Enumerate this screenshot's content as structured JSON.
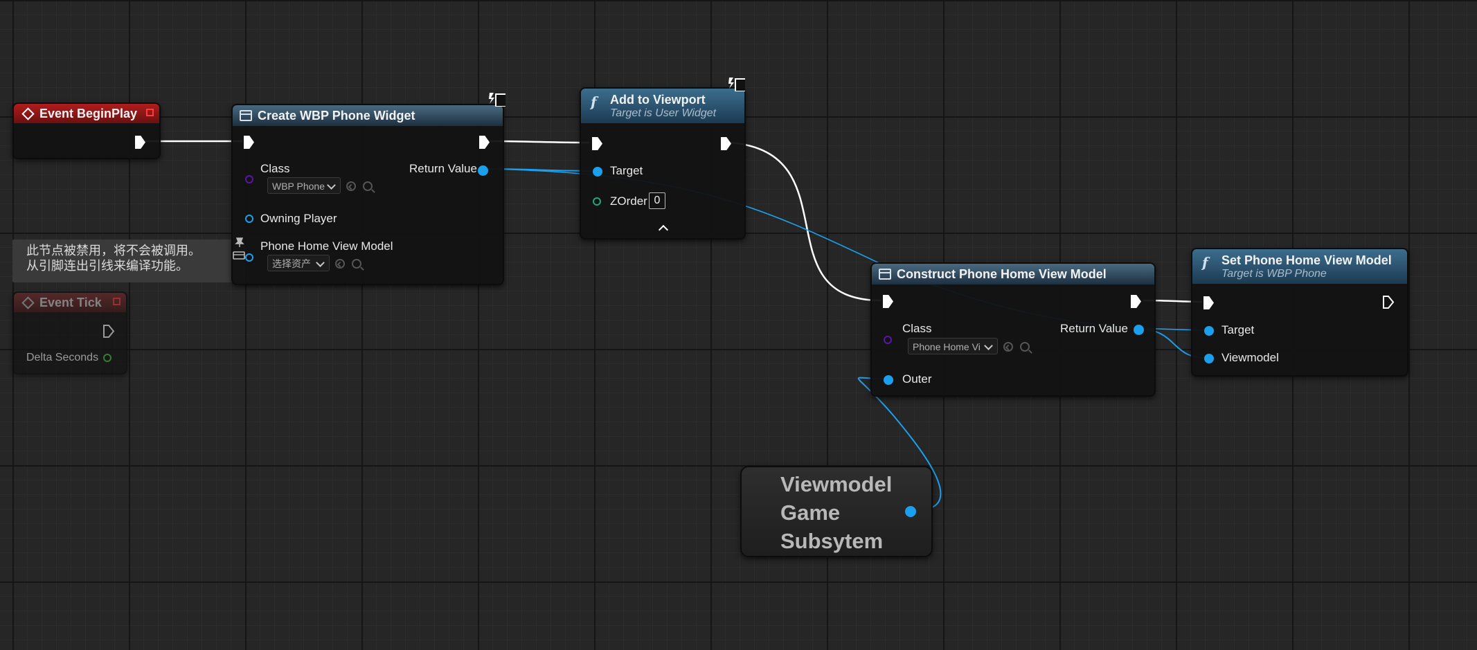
{
  "tooltip": {
    "line1": "此节点被禁用，将不会被调用。",
    "line2": "从引脚连出引线来编译功能。"
  },
  "event_beginplay": {
    "title": "Event BeginPlay"
  },
  "event_tick": {
    "title": "Event Tick",
    "pin_delta": "Delta Seconds"
  },
  "create_widget": {
    "title": "Create WBP Phone Widget",
    "pin_class": "Class",
    "class_value": "WBP Phone",
    "pin_return": "Return Value",
    "pin_owning_player": "Owning Player",
    "pin_phone_vm": "Phone Home View Model",
    "phone_vm_value": "选择资产"
  },
  "add_viewport": {
    "title": "Add to Viewport",
    "subtitle": "Target is User Widget",
    "pin_target": "Target",
    "pin_zorder": "ZOrder",
    "zorder_value": "0"
  },
  "construct_vm": {
    "title": "Construct Phone Home View Model",
    "pin_class": "Class",
    "class_value": "Phone Home Vi",
    "pin_return": "Return Value",
    "pin_outer": "Outer"
  },
  "set_vm": {
    "title": "Set Phone Home View Model",
    "subtitle": "Target is WBP Phone",
    "pin_target": "Target",
    "pin_viewmodel": "Viewmodel"
  },
  "subsystem": {
    "line1": "Viewmodel",
    "line2": "Game",
    "line3": "Subsytem"
  },
  "colors": {
    "exec": "#ffffff",
    "object_pin": "#1aa0ec",
    "class_pin": "#5a16a8",
    "event_header": "#b01d1d",
    "function_header": "#3c6e8e"
  }
}
